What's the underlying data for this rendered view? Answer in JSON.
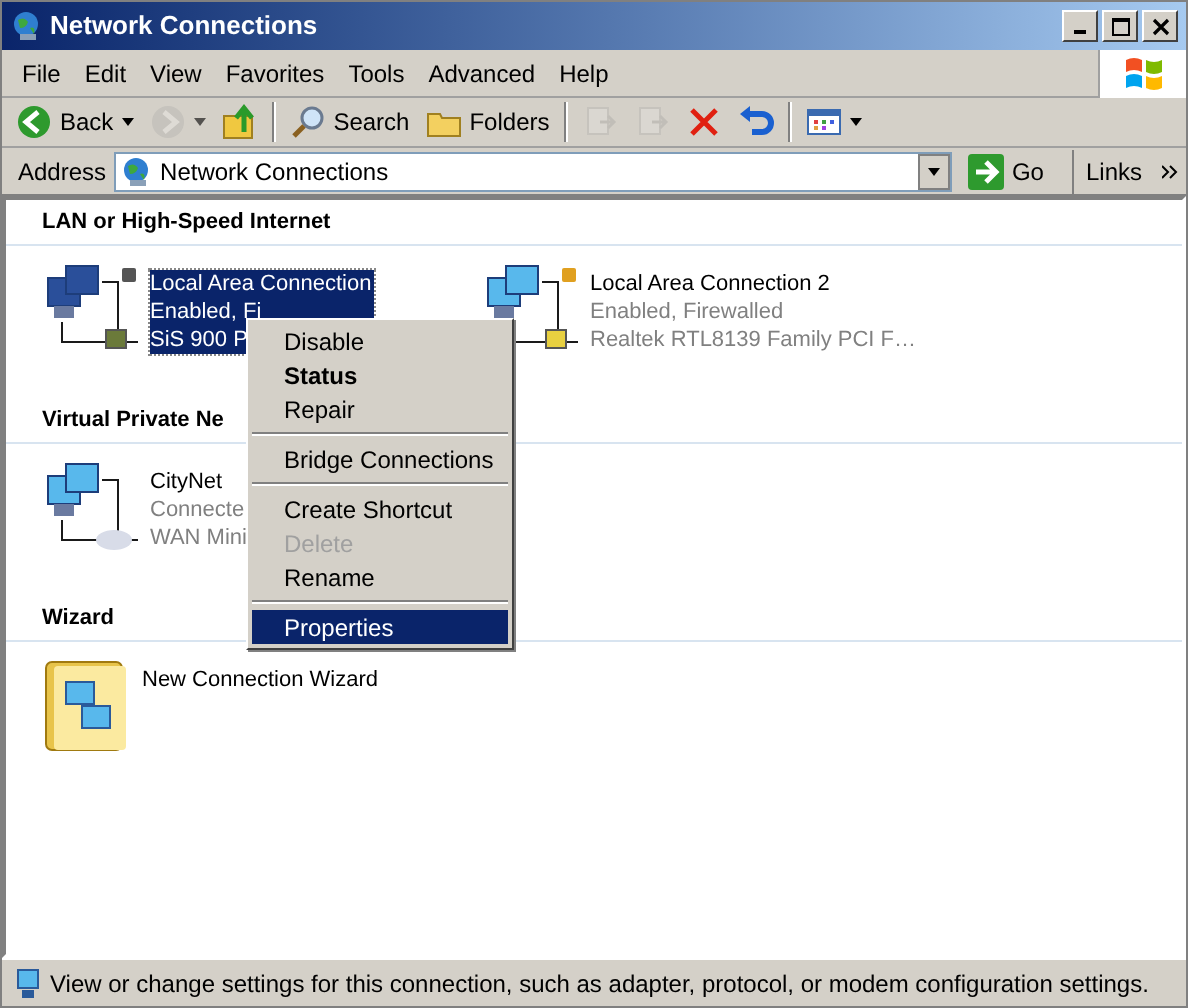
{
  "window": {
    "title": "Network Connections"
  },
  "menu": [
    {
      "label": "File"
    },
    {
      "label": "Edit"
    },
    {
      "label": "View"
    },
    {
      "label": "Favorites"
    },
    {
      "label": "Tools"
    },
    {
      "label": "Advanced"
    },
    {
      "label": "Help"
    }
  ],
  "toolbar": [
    {
      "kind": "back",
      "label": "Back",
      "disabled": false
    },
    {
      "kind": "forward",
      "disabled": true
    },
    {
      "kind": "up",
      "disabled": false
    },
    {
      "kind": "separator"
    },
    {
      "kind": "search",
      "label": "Search",
      "disabled": false
    },
    {
      "kind": "folders",
      "label": "Folders",
      "disabled": false
    },
    {
      "kind": "separator"
    },
    {
      "kind": "move",
      "disabled": true
    },
    {
      "kind": "copy",
      "disabled": true
    },
    {
      "kind": "delete",
      "disabled": false
    },
    {
      "kind": "undo",
      "disabled": false
    },
    {
      "kind": "separator"
    },
    {
      "kind": "views",
      "disabled": false
    }
  ],
  "address": {
    "label": "Address",
    "value": "Network Connections",
    "go": "Go",
    "links": "Links"
  },
  "groups": [
    {
      "title": "LAN or High-Speed Internet",
      "items": [
        {
          "kind": "lan",
          "name": "Local Area Connection",
          "lines": [
            "Enabled, Fi",
            "SiS 900 P"
          ],
          "selected": true
        },
        {
          "kind": "lan",
          "name": "Local Area Connection 2",
          "lines": [
            "Enabled, Firewalled",
            "Realtek RTL8139 Family PCI F…"
          ],
          "selected": false
        }
      ]
    },
    {
      "title": "Virtual Private Ne",
      "items": [
        {
          "kind": "vpn",
          "name": "CityNet",
          "lines": [
            "Connecte",
            "WAN Mini"
          ],
          "selected": false
        }
      ]
    },
    {
      "title": "Wizard",
      "items": [
        {
          "kind": "wizard",
          "name": "New Connection Wizard",
          "selected": false
        }
      ]
    }
  ],
  "context_menu": [
    {
      "kind": "item",
      "label": "Disable",
      "bold": false,
      "disabled": false,
      "selected": false
    },
    {
      "kind": "item",
      "label": "Status",
      "bold": true,
      "disabled": false,
      "selected": false
    },
    {
      "kind": "item",
      "label": "Repair",
      "bold": false,
      "disabled": false,
      "selected": false
    },
    {
      "kind": "separator"
    },
    {
      "kind": "item",
      "label": "Bridge Connections",
      "bold": false,
      "disabled": false,
      "selected": false
    },
    {
      "kind": "separator"
    },
    {
      "kind": "item",
      "label": "Create Shortcut",
      "bold": false,
      "disabled": false,
      "selected": false
    },
    {
      "kind": "item",
      "label": "Delete",
      "bold": false,
      "disabled": true,
      "selected": false
    },
    {
      "kind": "item",
      "label": "Rename",
      "bold": false,
      "disabled": false,
      "selected": false
    },
    {
      "kind": "separator"
    },
    {
      "kind": "item",
      "label": "Properties",
      "bold": false,
      "disabled": false,
      "selected": true
    }
  ],
  "status_bar": {
    "text": "View or change settings for this connection, such as adapter, protocol, or modem configuration settings."
  }
}
